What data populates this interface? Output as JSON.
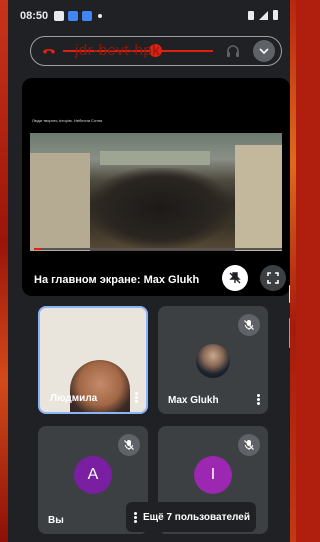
{
  "statusbar": {
    "time": "08:50",
    "icons": [
      "image-icon",
      "meet-icon",
      "meet-icon",
      "dot-icon"
    ],
    "right_icons": [
      "vibrate-icon",
      "signal-icon",
      "battery-icon"
    ]
  },
  "meeting": {
    "code": "jdr-bevt-hpk",
    "icons": [
      "phone-hangup-icon",
      "headphones-icon",
      "chevron-down-icon"
    ]
  },
  "presentation": {
    "video_title": "Люди творять історію. Небесна Сотня",
    "presenter_label": "На главном экране: Max Glukh",
    "progress": 0.03,
    "controls": [
      "unpin-icon",
      "fullscreen-icon"
    ]
  },
  "participants": [
    {
      "name": "Людмила",
      "type": "video",
      "muted": false,
      "highlighted": true
    },
    {
      "name": "Max Glukh",
      "type": "photo",
      "muted": true,
      "highlighted": false
    },
    {
      "name": "Вы",
      "type": "letter",
      "letter": "A",
      "avatar_color": "#7b1fa2",
      "muted": true
    },
    {
      "name": "",
      "type": "letter",
      "letter": "I",
      "avatar_color": "#9c27b0",
      "muted": true
    }
  ],
  "more_people": "Ещё 7 пользователей",
  "colors": {
    "accent_border": "#8ab4f8",
    "background": "#202124",
    "tile": "#3c4043",
    "frame": "#b01e0e"
  }
}
